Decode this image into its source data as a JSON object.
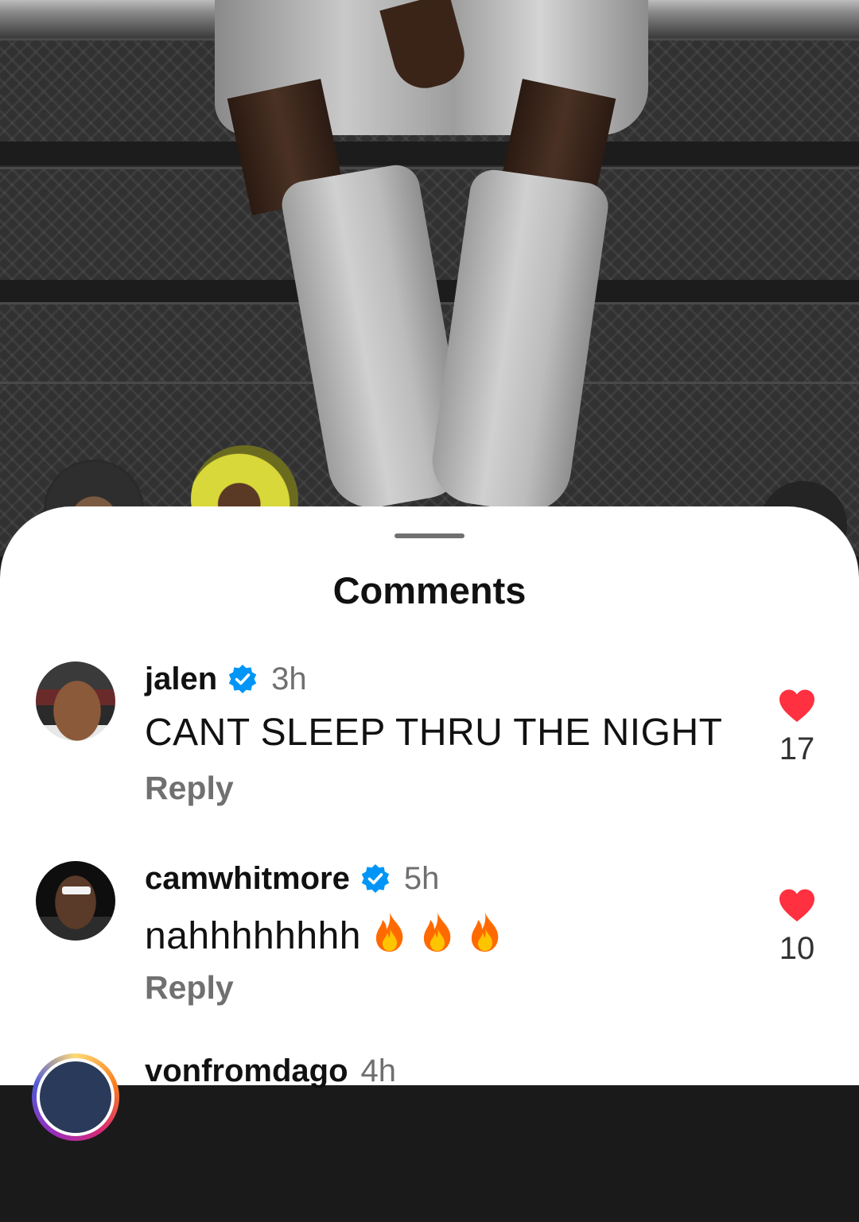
{
  "sheet": {
    "title": "Comments"
  },
  "comments": [
    {
      "username": "jalen",
      "verified": true,
      "time": "3h",
      "text": "CANT SLEEP THRU THE NIGHT",
      "reply_label": "Reply",
      "likes": "17"
    },
    {
      "username": "camwhitmore",
      "verified": true,
      "time": "5h",
      "text": "nahhhhhhhh",
      "emoji": [
        "fire-emoji",
        "fire-emoji",
        "fire-emoji"
      ],
      "reply_label": "Reply",
      "likes": "10"
    },
    {
      "username": "vonfromdago",
      "time": "4h"
    }
  ],
  "colors": {
    "accent_like": "#ff3040",
    "verified_blue": "#0095f6",
    "sheet_bg": "#ffffff",
    "muted_text": "#707070"
  },
  "icons": {
    "verified": "verified-badge-icon",
    "like": "heart-icon",
    "emoji": "fire-emoji"
  }
}
